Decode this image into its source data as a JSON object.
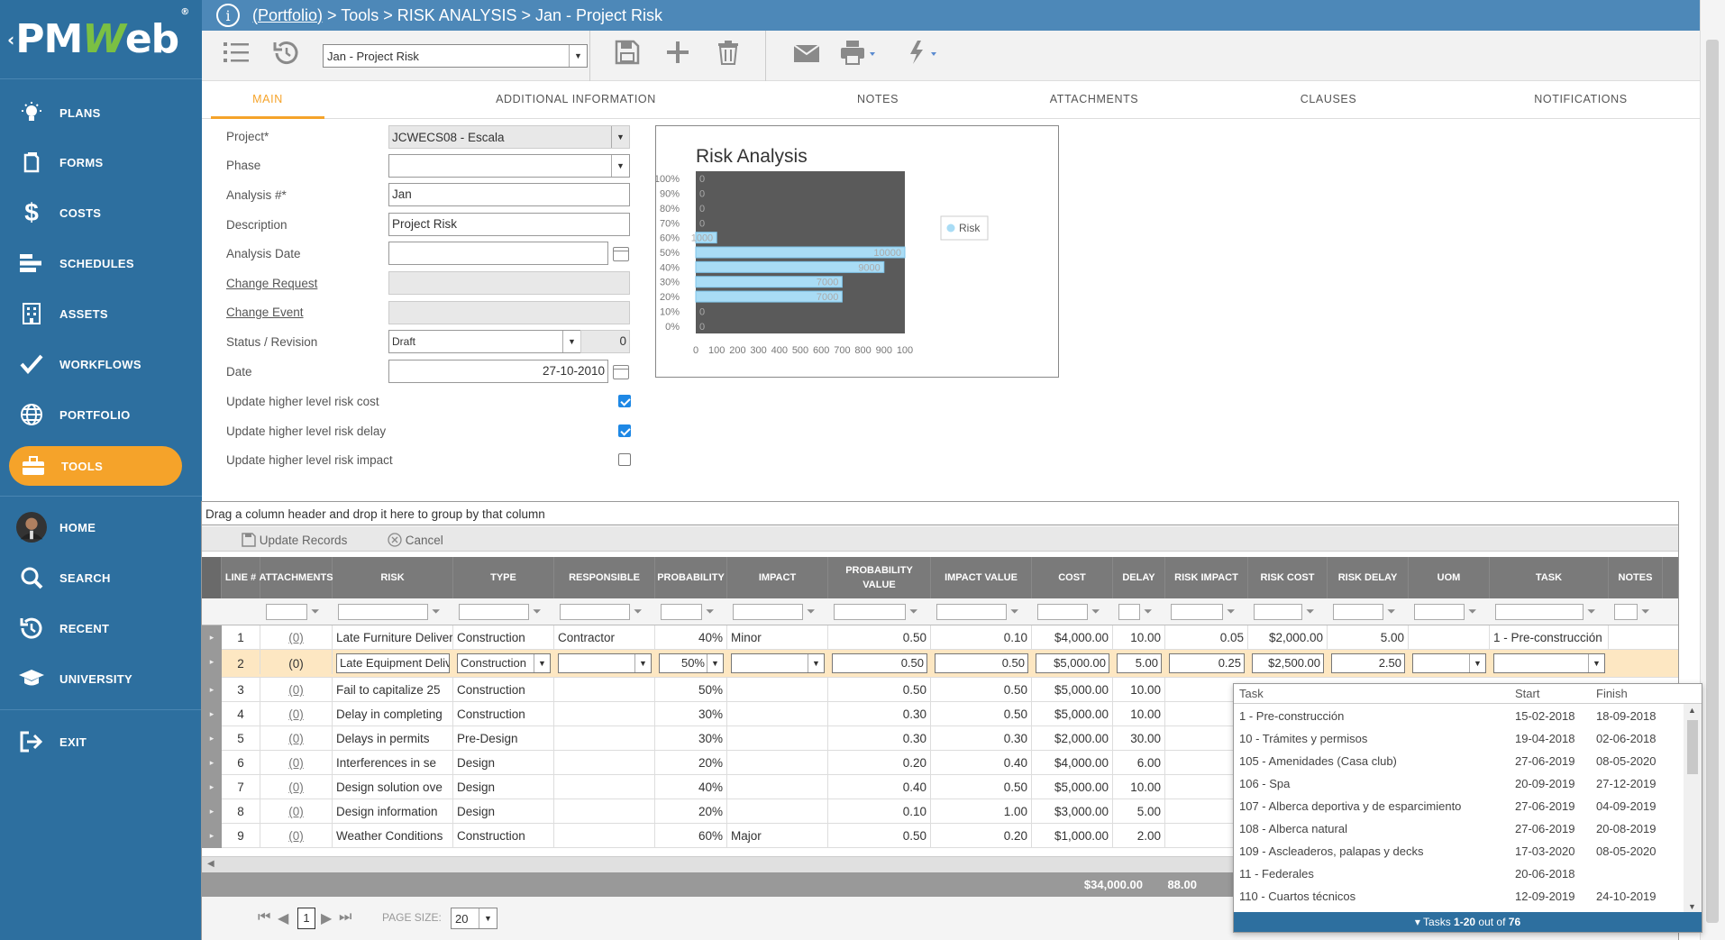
{
  "app": {
    "logo_text_left": "PM",
    "logo_text_w": "W",
    "logo_text_right": "eb",
    "logo_mark": "®"
  },
  "sidebar": {
    "items": [
      {
        "label": "PLANS",
        "icon": "lightbulb-icon"
      },
      {
        "label": "FORMS",
        "icon": "forms-icon"
      },
      {
        "label": "COSTS",
        "icon": "dollar-icon"
      },
      {
        "label": "SCHEDULES",
        "icon": "schedules-icon"
      },
      {
        "label": "ASSETS",
        "icon": "building-icon"
      },
      {
        "label": "WORKFLOWS",
        "icon": "checkmark-icon"
      },
      {
        "label": "PORTFOLIO",
        "icon": "globe-icon"
      },
      {
        "label": "TOOLS",
        "icon": "toolbox-icon",
        "active": true
      },
      {
        "label": "HOME",
        "icon": "avatar"
      },
      {
        "label": "SEARCH",
        "icon": "search-icon"
      },
      {
        "label": "RECENT",
        "icon": "history-icon"
      },
      {
        "label": "UNIVERSITY",
        "icon": "graduation-cap-icon"
      },
      {
        "label": "EXIT",
        "icon": "exit-icon"
      }
    ]
  },
  "breadcrumb": {
    "portfolio": "(Portfolio)",
    "rest": " > Tools > RISK ANALYSIS > Jan - Project Risk"
  },
  "toolbar": {
    "record_select": "Jan - Project Risk"
  },
  "tabs": [
    "MAIN",
    "ADDITIONAL INFORMATION",
    "NOTES",
    "ATTACHMENTS",
    "CLAUSES",
    "NOTIFICATIONS"
  ],
  "form": {
    "project_label": "Project*",
    "project_value": "JCWECS08 - Escala",
    "phase_label": "Phase",
    "phase_value": "",
    "analysis_label": "Analysis #*",
    "analysis_value": "Jan",
    "description_label": "Description",
    "description_value": "Project Risk",
    "analysis_date_label": "Analysis Date",
    "analysis_date_value": "",
    "change_request_label": "Change Request",
    "change_event_label": "Change Event",
    "status_label": "Status / Revision",
    "status_value": "Draft",
    "revision_value": "0",
    "date_label": "Date",
    "date_value": "27-10-2010",
    "cb1_label": "Update higher level risk cost",
    "cb1_checked": true,
    "cb2_label": "Update higher level risk delay",
    "cb2_checked": true,
    "cb3_label": "Update higher level risk impact",
    "cb3_checked": false
  },
  "chart_data": {
    "type": "bar",
    "orientation": "horizontal",
    "title": "Risk Analysis",
    "categories": [
      "100%",
      "90%",
      "80%",
      "70%",
      "60%",
      "50%",
      "40%",
      "30%",
      "20%",
      "10%",
      "0%"
    ],
    "series": [
      {
        "name": "Risk",
        "values": [
          0,
          0,
          0,
          0,
          1000,
          10000,
          9000,
          7000,
          7000,
          0,
          0
        ]
      }
    ],
    "data_labels": [
      "0",
      "0",
      "0",
      "0",
      "1000",
      "10000",
      "9000",
      "7000",
      "7000",
      "0",
      "0"
    ],
    "x_ticks": [
      "0",
      "100",
      "200",
      "300",
      "400",
      "500",
      "600",
      "700",
      "800",
      "900",
      "100"
    ],
    "xlim": [
      0,
      10000
    ],
    "legend": "right",
    "colors": {
      "bar": "#a9dcf5",
      "plot_bg": "#5a5a5a"
    }
  },
  "grid": {
    "group_hint": "Drag a column header and drop it here to group by that column",
    "update_records": "Update Records",
    "cancel": "Cancel",
    "columns": [
      "LINE #",
      "ATTACHMENTS",
      "RISK",
      "TYPE",
      "RESPONSIBLE",
      "PROBABILITY",
      "IMPACT",
      "PROBABILITY VALUE",
      "IMPACT VALUE",
      "COST",
      "DELAY",
      "RISK IMPACT",
      "RISK COST",
      "RISK DELAY",
      "UOM",
      "TASK",
      "NOTES"
    ],
    "rows": [
      {
        "line": "1",
        "att": "(0)",
        "risk": "Late Furniture Delivery",
        "type": "Construction",
        "resp": "Contractor",
        "prob": "40%",
        "impact": "Minor",
        "pv": "0.50",
        "iv": "0.10",
        "cost": "$4,000.00",
        "delay": "10.00",
        "ri": "0.05",
        "rc": "$2,000.00",
        "rd": "5.00",
        "uom": "",
        "task": "1 - Pre-construcción"
      },
      {
        "line": "2",
        "att": "(0)",
        "risk": "Late Equipment Delivery",
        "type": "Construction",
        "resp": "",
        "prob": "50%",
        "impact": "",
        "pv": "0.50",
        "iv": "0.50",
        "cost": "$5,000.00",
        "delay": "5.00",
        "ri": "0.25",
        "rc": "$2,500.00",
        "rd": "2.50",
        "uom": "",
        "task": "",
        "editing": true
      },
      {
        "line": "3",
        "att": "(0)",
        "risk": "Fail to capitalize 25",
        "type": "Construction",
        "resp": "",
        "prob": "50%",
        "impact": "",
        "pv": "0.50",
        "iv": "0.50",
        "cost": "$5,000.00",
        "delay": "10.00"
      },
      {
        "line": "4",
        "att": "(0)",
        "risk": "Delay in completing",
        "type": "Construction",
        "resp": "",
        "prob": "30%",
        "impact": "",
        "pv": "0.30",
        "iv": "0.50",
        "cost": "$5,000.00",
        "delay": "10.00"
      },
      {
        "line": "5",
        "att": "(0)",
        "risk": "Delays in permits",
        "type": "Pre-Design",
        "resp": "",
        "prob": "30%",
        "impact": "",
        "pv": "0.30",
        "iv": "0.30",
        "cost": "$2,000.00",
        "delay": "30.00"
      },
      {
        "line": "6",
        "att": "(0)",
        "risk": "Interferences in se",
        "type": "Design",
        "resp": "",
        "prob": "20%",
        "impact": "",
        "pv": "0.20",
        "iv": "0.40",
        "cost": "$4,000.00",
        "delay": "6.00"
      },
      {
        "line": "7",
        "att": "(0)",
        "risk": "Design solution ove",
        "type": "Design",
        "resp": "",
        "prob": "40%",
        "impact": "",
        "pv": "0.40",
        "iv": "0.50",
        "cost": "$5,000.00",
        "delay": "10.00"
      },
      {
        "line": "8",
        "att": "(0)",
        "risk": "Design information",
        "type": "Design",
        "resp": "",
        "prob": "20%",
        "impact": "",
        "pv": "0.10",
        "iv": "1.00",
        "cost": "$3,000.00",
        "delay": "5.00"
      },
      {
        "line": "9",
        "att": "(0)",
        "risk": "Weather Conditions",
        "type": "Construction",
        "resp": "",
        "prob": "60%",
        "impact": "Major",
        "pv": "0.50",
        "iv": "0.20",
        "cost": "$1,000.00",
        "delay": "2.00"
      }
    ],
    "totals": {
      "cost": "$34,000.00",
      "delay": "88.00"
    },
    "pager": {
      "page": "1",
      "page_size_label": "PAGE SIZE:",
      "page_size": "20"
    }
  },
  "task_dropdown": {
    "headers": {
      "task": "Task",
      "start": "Start",
      "finish": "Finish"
    },
    "items": [
      {
        "task": "1 - Pre-construcción",
        "start": "15-02-2018",
        "finish": "18-09-2018"
      },
      {
        "task": "10 - Trámites y permisos",
        "start": "19-04-2018",
        "finish": "02-06-2018"
      },
      {
        "task": "105 - Amenidades (Casa club)",
        "start": "27-06-2019",
        "finish": "08-05-2020"
      },
      {
        "task": "106 - Spa",
        "start": "20-09-2019",
        "finish": "27-12-2019"
      },
      {
        "task": "107 - Alberca deportiva y de esparcimiento",
        "start": "27-06-2019",
        "finish": "04-09-2019"
      },
      {
        "task": "108 - Alberca natural",
        "start": "27-06-2019",
        "finish": "20-08-2019"
      },
      {
        "task": "109 - Ascleaderos, palapas y decks",
        "start": "17-03-2020",
        "finish": "08-05-2020"
      },
      {
        "task": "11 - Federales",
        "start": "20-06-2018",
        "finish": ""
      },
      {
        "task": "110 - Cuartos técnicos",
        "start": "12-09-2019",
        "finish": "24-10-2019"
      }
    ],
    "footer_prefix": "Tasks ",
    "footer_range": "1-20",
    "footer_mid": " out of ",
    "footer_total": "76"
  },
  "colors": {
    "sidebar": "#2d6f9f",
    "accent": "#f5a32a",
    "topbar": "#4d88b8",
    "grid_header": "#7a7a7a",
    "selected_row": "#fde7c2"
  }
}
